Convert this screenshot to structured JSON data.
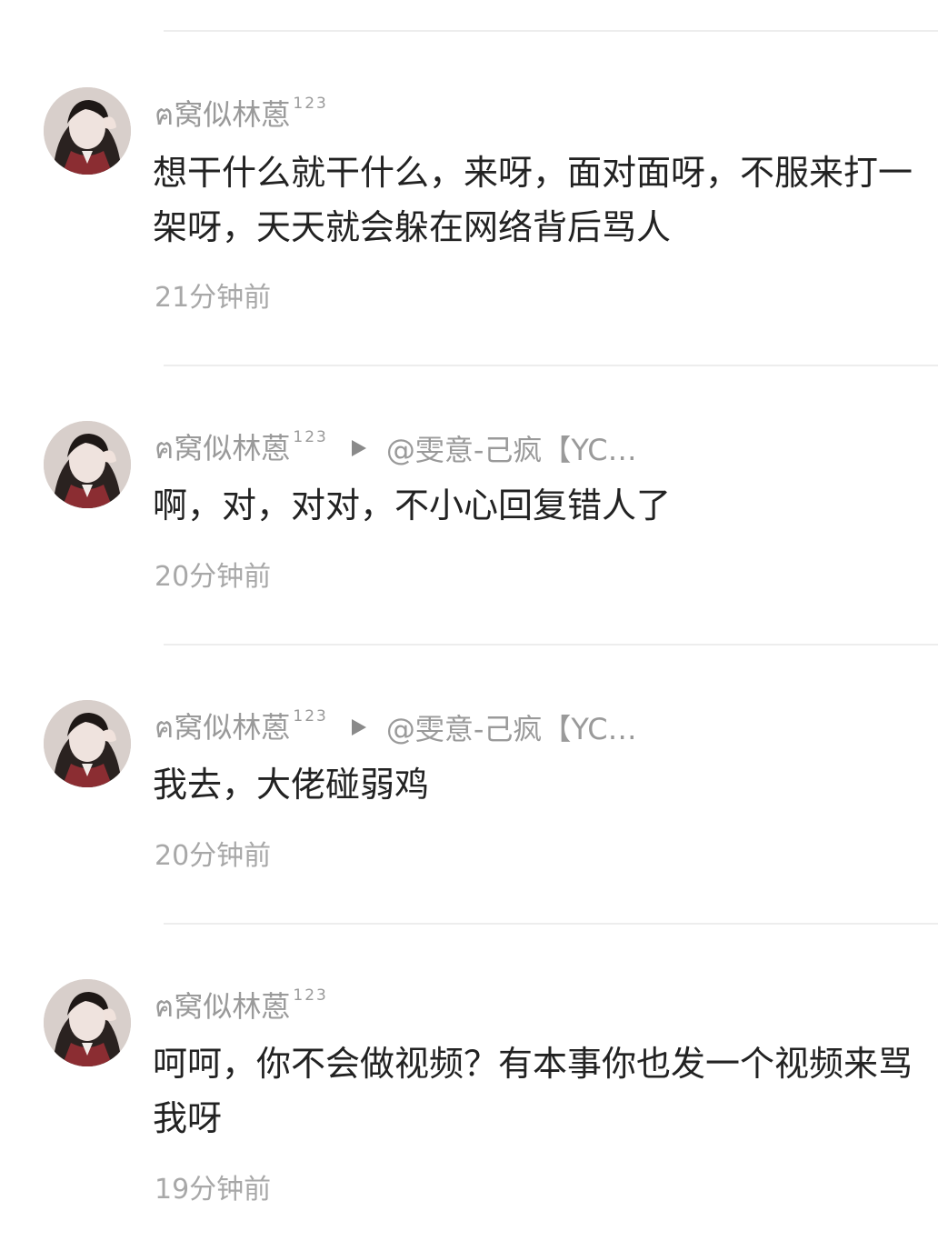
{
  "comments": [
    {
      "author": "ฅ窝似林蒽",
      "badge": "123",
      "reply_to": "",
      "text": "想干什么就干什么，来呀，面对面呀，不服来打一架呀，天天就会躲在网络背后骂人",
      "time": "21分钟前"
    },
    {
      "author": "ฅ窝似林蒽",
      "badge": "123",
      "reply_to": "@雯意-己疯【YC…",
      "text": "啊，对，对对，不小心回复错人了",
      "time": "20分钟前"
    },
    {
      "author": "ฅ窝似林蒽",
      "badge": "123",
      "reply_to": "@雯意-己疯【YC…",
      "text": "我去，大佬碰弱鸡",
      "time": "20分钟前"
    },
    {
      "author": "ฅ窝似林蒽",
      "badge": "123",
      "reply_to": "",
      "text": "呵呵，你不会做视频？有本事你也发一个视频来骂我呀",
      "time": "19分钟前"
    }
  ],
  "icons": {
    "reply_arrow": "play-triangle-icon",
    "avatar": "user-avatar"
  },
  "colors": {
    "text": "#222222",
    "meta": "#9a9a9a",
    "divider": "#ededed"
  }
}
